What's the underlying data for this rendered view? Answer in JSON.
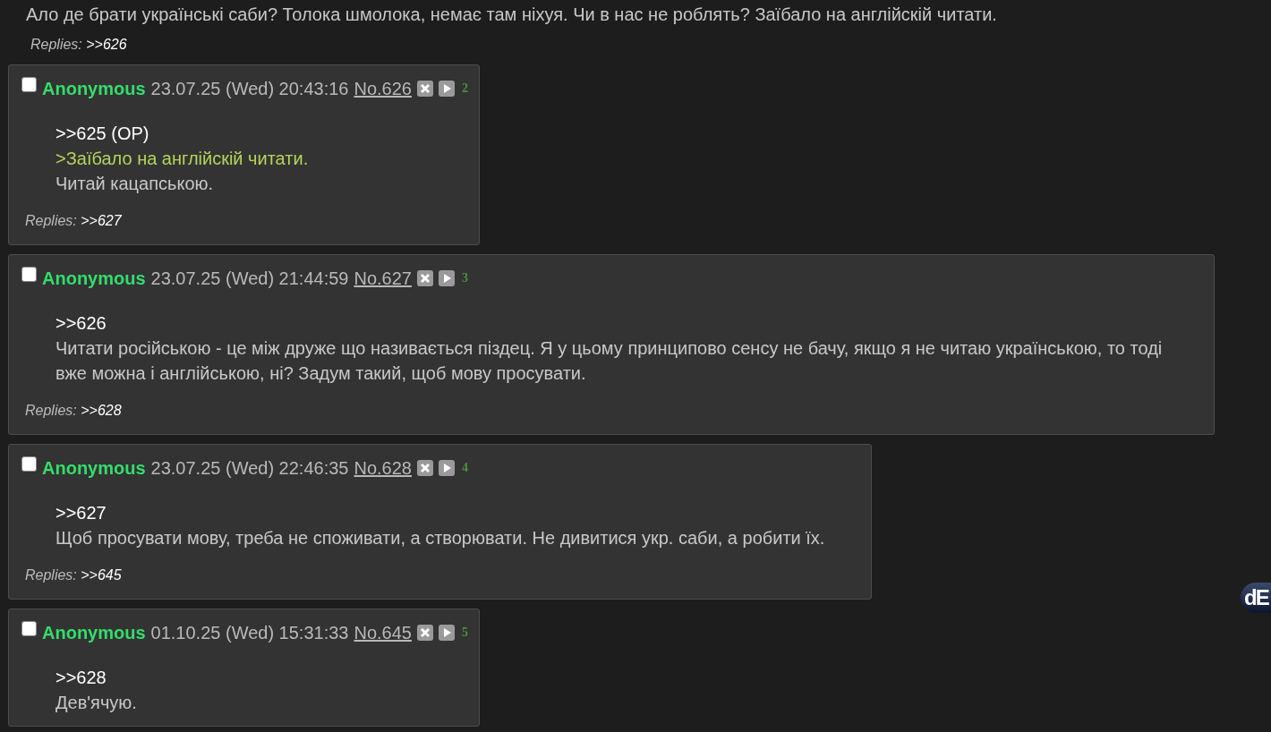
{
  "op_tail": {
    "text": "Ало де брати українські саби? Толока шмолока, немає там ніхуя. Чи в нас не роблять? Заїбало на англійскій читати.",
    "replies_label": "Replies:",
    "replies": [
      ">>626"
    ]
  },
  "posts": [
    {
      "checked": false,
      "name": "Anonymous",
      "date": "23.07.25 (Wed) 20:43:16",
      "number": "No.626",
      "index": "2",
      "lines": [
        {
          "kind": "link",
          "text": ">>625 (OP)"
        },
        {
          "kind": "quote",
          "text": ">Заїбало на англійскій читати."
        },
        {
          "kind": "text",
          "text": "Читай кацапською."
        }
      ],
      "replies_label": "Replies:",
      "replies": [
        ">>627"
      ]
    },
    {
      "checked": false,
      "name": "Anonymous",
      "date": "23.07.25 (Wed) 21:44:59",
      "number": "No.627",
      "index": "3",
      "lines": [
        {
          "kind": "link",
          "text": ">>626"
        },
        {
          "kind": "text",
          "text": "Читати російською - це між друже що називається піздец. Я у цьому принципово сенсу не бачу, якщо я не читаю українською, то тоді вже можна і англійською, ні? Задум такий, щоб мову просувати."
        }
      ],
      "replies_label": "Replies:",
      "replies": [
        ">>628"
      ]
    },
    {
      "checked": false,
      "name": "Anonymous",
      "date": "23.07.25 (Wed) 22:46:35",
      "number": "No.628",
      "index": "4",
      "lines": [
        {
          "kind": "link",
          "text": ">>627"
        },
        {
          "kind": "text",
          "text": "Щоб просувати мову, треба не споживати, а створювати. Не дивитися укр. саби, а робити їх."
        }
      ],
      "replies_label": "Replies:",
      "replies": [
        ">>645"
      ]
    },
    {
      "checked": false,
      "name": "Anonymous",
      "date": "01.10.25 (Wed) 15:31:33",
      "number": "No.645",
      "index": "5",
      "lines": [
        {
          "kind": "link",
          "text": ">>628"
        },
        {
          "kind": "text",
          "text": "Дев'ячую."
        }
      ]
    }
  ],
  "side_badge": {
    "text": "dE"
  }
}
